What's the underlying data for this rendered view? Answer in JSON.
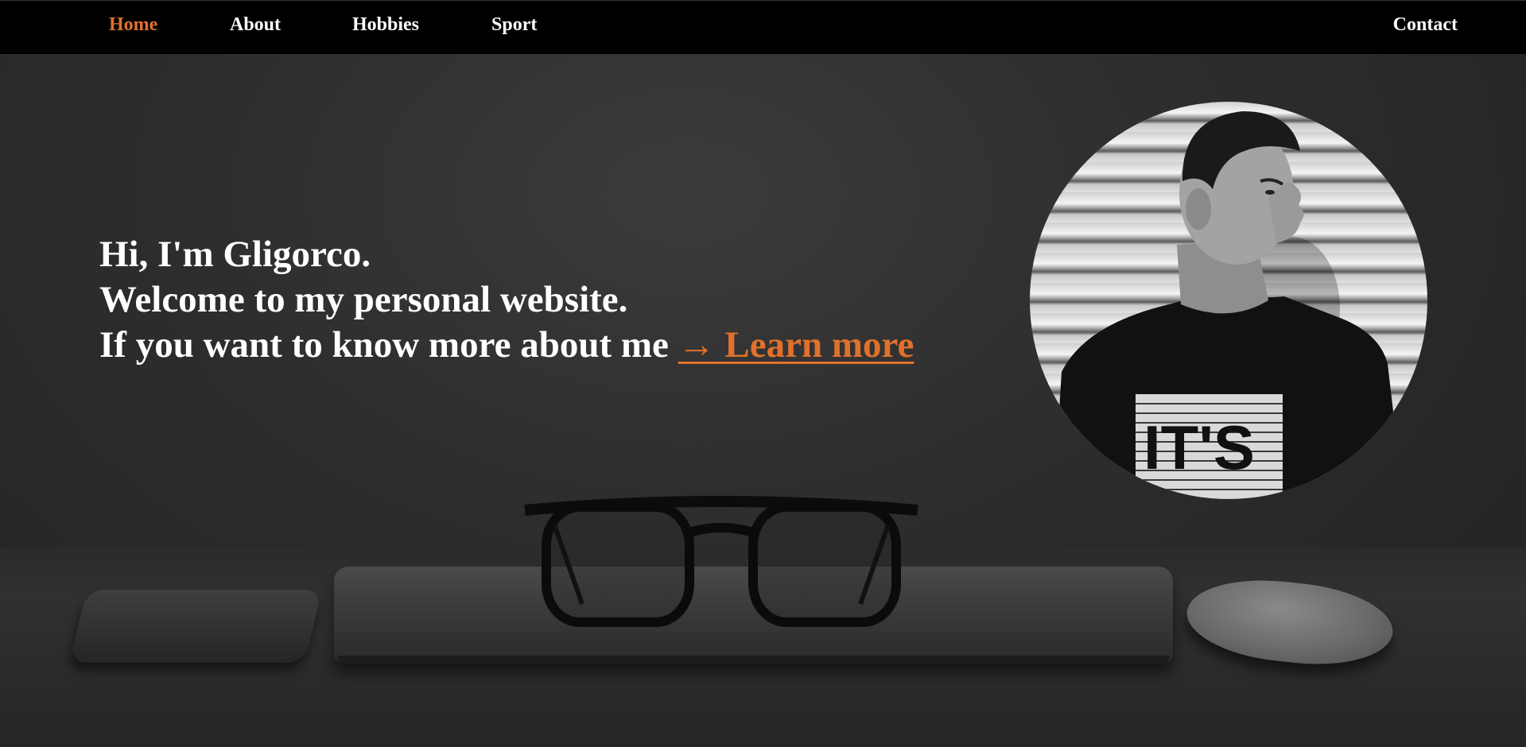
{
  "nav": {
    "items": [
      {
        "label": "Home",
        "active": true
      },
      {
        "label": "About",
        "active": false
      },
      {
        "label": "Hobbies",
        "active": false
      },
      {
        "label": "Sport",
        "active": false
      }
    ],
    "contact_label": "Contact"
  },
  "hero": {
    "greeting": "Hi, I'm Gligorco.",
    "welcome": "Welcome to my personal website.",
    "cta_prefix": "If you want to know more about me ",
    "cta_link": "→ Learn more"
  },
  "portrait": {
    "shirt_text": "IT'S"
  },
  "colors": {
    "accent": "#e0712c",
    "nav_background": "#000000",
    "text": "#ffffff"
  }
}
